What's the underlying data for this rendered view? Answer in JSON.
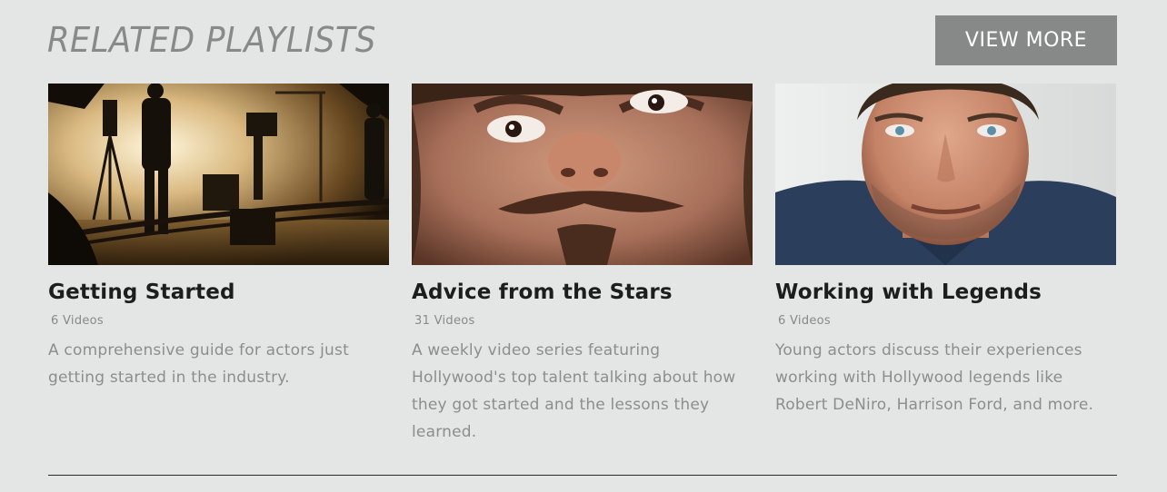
{
  "section": {
    "title": "RELATED PLAYLISTS",
    "view_more_label": "VIEW MORE"
  },
  "playlists": [
    {
      "title": "Getting Started",
      "count": "6 Videos",
      "description": "A comprehensive guide for actors just getting started in the industry."
    },
    {
      "title": "Advice from the Stars",
      "count": "31 Videos",
      "description": "A weekly video series featuring Hollywood's top talent talking about how they got started and the lessons they learned."
    },
    {
      "title": "Working with Legends",
      "count": "6 Videos",
      "description": "Young actors discuss their experiences working with Hollywood legends like Robert DeNiro, Harrison Ford, and more."
    }
  ],
  "colors": {
    "background": "#e3e6e5",
    "button": "#878988",
    "title_text": "#1d1d1d",
    "muted_text": "#8c8e8d"
  }
}
